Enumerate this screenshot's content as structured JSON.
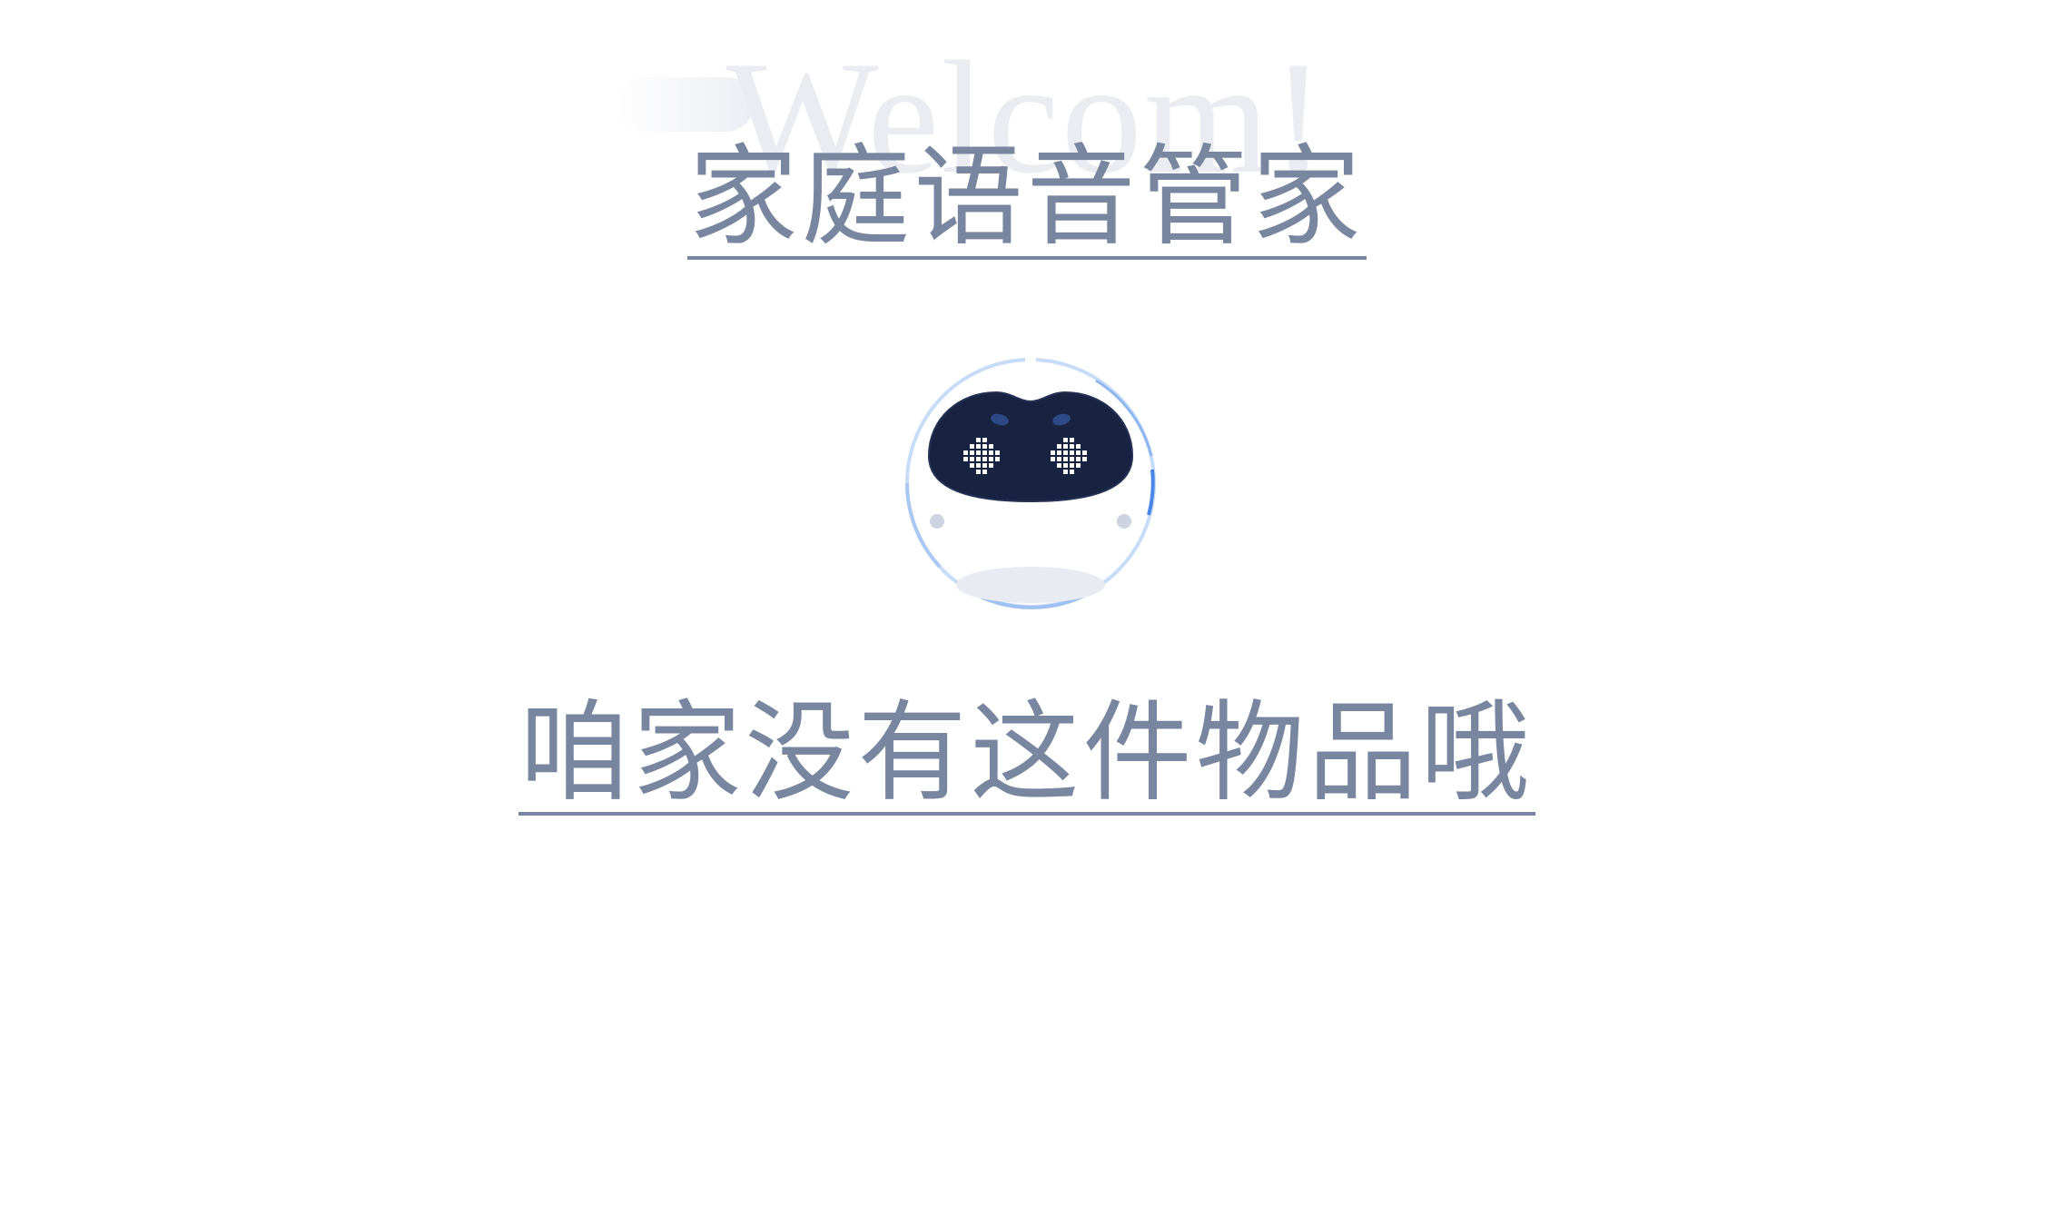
{
  "header": {
    "watermark_text": "Welcom!",
    "app_title": "家庭语音管家"
  },
  "assistant": {
    "avatar_icon": "robot-icon",
    "response_text": "咱家没有这件物品哦"
  },
  "colors": {
    "text_primary": "#7886a0",
    "watermark": "#eaecf2",
    "robot_face": "#172340",
    "ring_accent": "#4a86e8",
    "ring_light": "#b9d3f5"
  }
}
